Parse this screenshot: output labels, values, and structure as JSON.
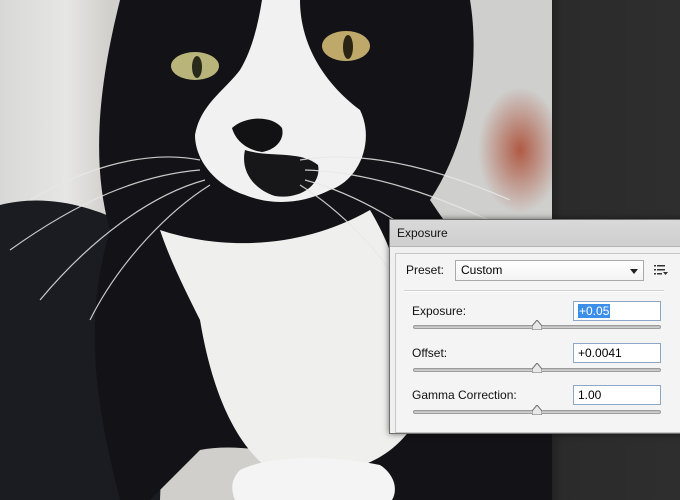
{
  "dialog": {
    "title": "Exposure",
    "preset_label": "Preset:",
    "preset_value": "Custom",
    "controls": [
      {
        "label": "Exposure:",
        "value": "+0.05",
        "slider_fraction": 0.5
      },
      {
        "label": "Offset:",
        "value": "+0.0041",
        "slider_fraction": 0.5
      },
      {
        "label": "Gamma Correction:",
        "value": "1.00",
        "slider_fraction": 0.5
      }
    ]
  },
  "colors": {
    "selection": "#3b8eea",
    "dialog_bg": "#f0f0f0",
    "app_bg": "#2b2b2b"
  },
  "icons": {
    "preset_menu": "list-menu-icon",
    "preset_dropdown": "chevron-down-icon"
  }
}
